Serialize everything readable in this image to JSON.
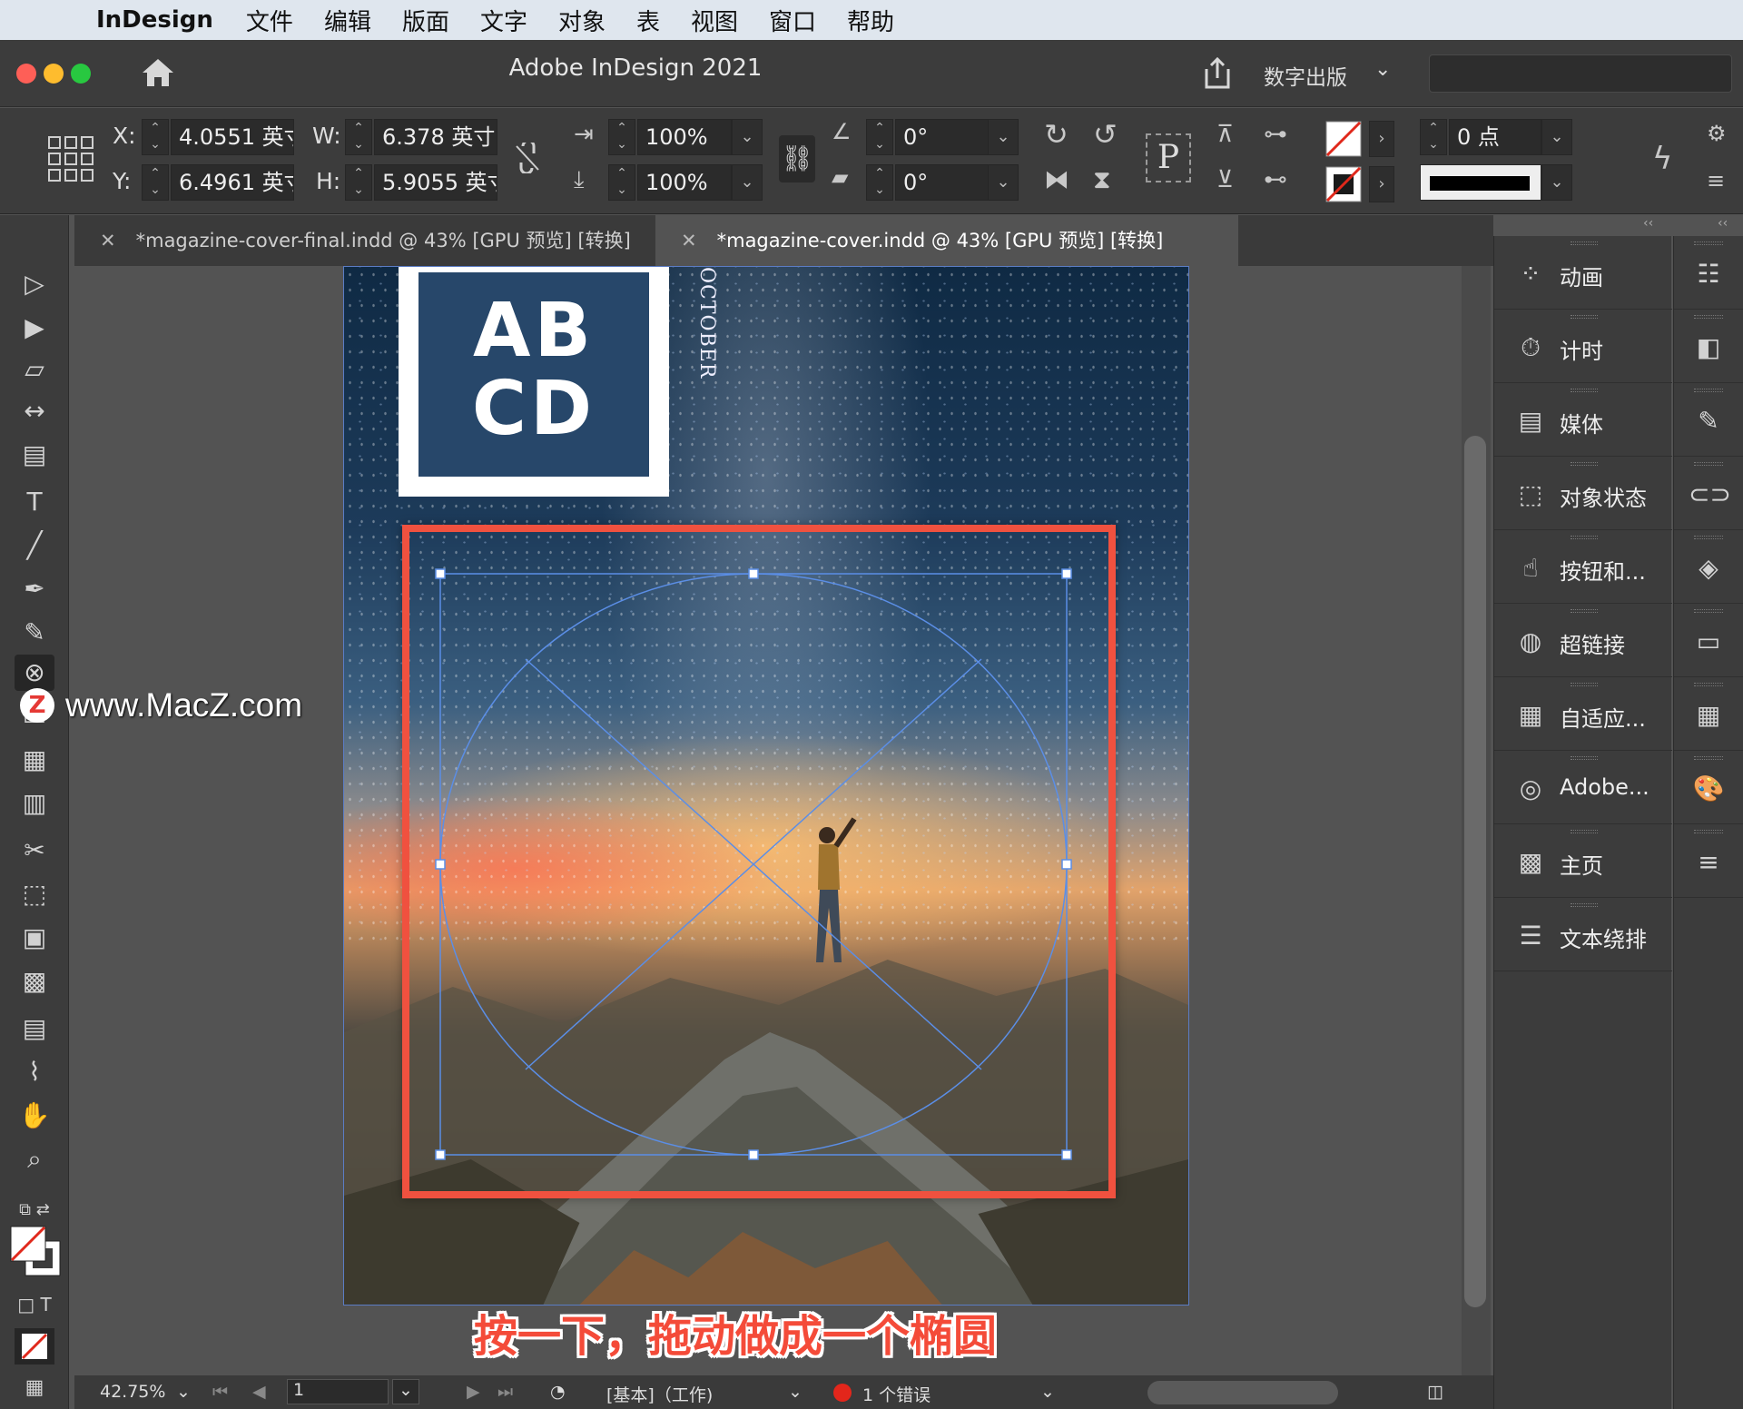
{
  "menubar": {
    "app": "InDesign",
    "items": [
      "文件",
      "编辑",
      "版面",
      "文字",
      "对象",
      "表",
      "视图",
      "窗口",
      "帮助"
    ]
  },
  "window": {
    "title": "Adobe InDesign 2021",
    "workspace": "数字出版"
  },
  "control": {
    "x_label": "X:",
    "x_value": "4.0551 英寸",
    "y_label": "Y:",
    "y_value": "6.4961 英寸",
    "w_label": "W:",
    "w_value": "6.378 英寸",
    "h_label": "H:",
    "h_value": "5.9055 英寸",
    "scale_x": "100%",
    "scale_y": "100%",
    "rotate": "0°",
    "shear": "0°",
    "stroke_weight": "0 点",
    "proxy_letter": "P"
  },
  "tabs": [
    {
      "label": "*magazine-cover-final.indd @ 43% [GPU 预览] [转换]",
      "active": false
    },
    {
      "label": "*magazine-cover.indd @ 43% [GPU 预览] [转换]",
      "active": true
    }
  ],
  "cover": {
    "logo_line1": "AB",
    "logo_line2": "CD",
    "month": "OCTOBER"
  },
  "watermark": "www.MacZ.com",
  "subtitle": "按一下，拖动做成一个椭圆",
  "status": {
    "zoom": "42.75%",
    "page": "1",
    "style": "[基本]（工作)",
    "errors": "1 个错误"
  },
  "panels": [
    {
      "label": "动画",
      "icon": "animation-icon"
    },
    {
      "label": "计时",
      "icon": "timing-icon"
    },
    {
      "label": "媒体",
      "icon": "media-icon"
    },
    {
      "label": "对象状态",
      "icon": "object-states-icon"
    },
    {
      "label": "按钮和...",
      "icon": "buttons-icon"
    },
    {
      "label": "超链接",
      "icon": "hyperlinks-icon"
    },
    {
      "label": "自适应...",
      "icon": "liquid-layout-icon"
    },
    {
      "label": "Adobe...",
      "icon": "adobe-icon"
    },
    {
      "label": "主页",
      "icon": "pages-icon"
    },
    {
      "label": "文本绕排",
      "icon": "text-wrap-icon"
    }
  ],
  "colors": {
    "frame_red": "#f0513f",
    "selection_blue": "#5b8ee6",
    "subtitle_red": "#f44b39"
  }
}
